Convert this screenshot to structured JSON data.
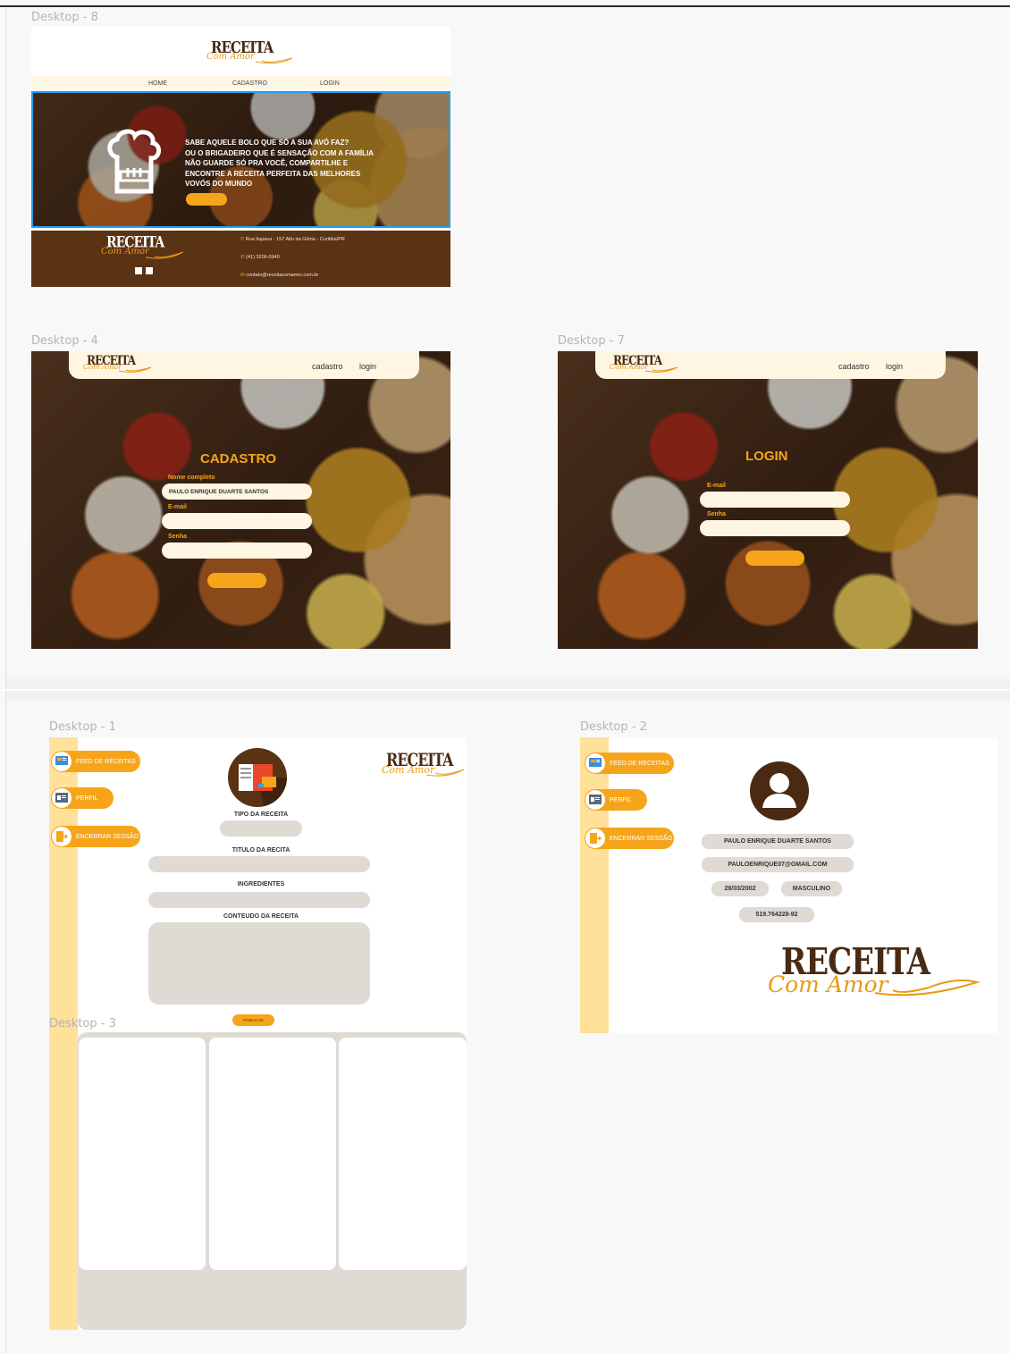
{
  "frames": {
    "home": {
      "label": "Desktop - 8"
    },
    "cadastro": {
      "label": "Desktop - 4"
    },
    "login": {
      "label": "Desktop - 7"
    },
    "post": {
      "label": "Desktop - 1"
    },
    "profile": {
      "label": "Desktop - 2"
    },
    "feed": {
      "label": "Desktop - 3"
    }
  },
  "logo": {
    "main": "RECEITA",
    "script": "Com Amor"
  },
  "home": {
    "nav": [
      "HOME",
      "CADASTRO",
      "LOGIN"
    ],
    "hero_lines": [
      "SABE AQUELE BOLO QUE SÓ A SUA AVÓ FAZ?",
      "OU O BRIGADEIRO QUE É SENSAÇÃO COM A FAMÍLIA",
      "NÃO GUARDE SÓ PRA VOCÊ, COMPARTILHE E",
      "ENCONTRE  A RECEITA PERFEITA DAS MELHORES",
      "VOVÓS DO MUNDO"
    ],
    "footer": {
      "address": "Rua Itupava - 157 Alto da Glória - Curitiba/PR",
      "phone": "(41) 3206-0940",
      "email": "contato@receitacomamor.com.br",
      "social_icons": [
        "facebook-icon",
        "instagram-icon"
      ]
    }
  },
  "cadastro": {
    "nav": [
      "cadastro",
      "login"
    ],
    "title": "CADASTRO",
    "name_label": "Nome completo",
    "name_value": "PAULO ENRIQUE DUARTE SANTOS",
    "email_label": "E-mail",
    "password_label": "Senha"
  },
  "login": {
    "nav": [
      "cadastro",
      "login"
    ],
    "title": "LOGIN",
    "email_label": "E-mail",
    "password_label": "Senha"
  },
  "sidebar": {
    "items": [
      {
        "label": "FEED DE RECEITAS",
        "icon": "feed-icon"
      },
      {
        "label": "PERFIL",
        "icon": "profile-card-icon"
      },
      {
        "label": "ENCERRAR SESSÃO",
        "icon": "logout-icon"
      }
    ]
  },
  "post": {
    "type_label": "TIPO DA RECEITA",
    "title_label": "TITULO DA RECITA",
    "ingredients_label": "INGREDIENTES",
    "content_label": "CONTEUDO DA RECEITA",
    "publish_label": "PUBLICAR"
  },
  "profile": {
    "name": "PAULO ENRIQUE DUARTE SANTOS",
    "email": "PAULOENRIQUE07@GMAIL.COM",
    "birth": "28/03/2002",
    "gender": "MASCULINO",
    "id_number": "519.764228-92"
  },
  "colors": {
    "accent": "#f6a51a",
    "brown": "#4a2a12",
    "cream": "#fff5e3",
    "sidebar": "#ffe19a",
    "field_grey": "#e0dad5"
  }
}
